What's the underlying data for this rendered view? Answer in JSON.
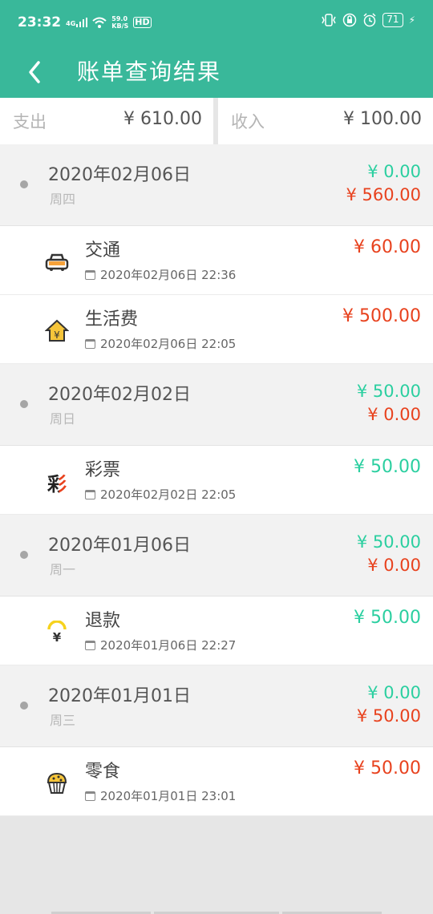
{
  "status": {
    "time": "23:32",
    "net": "4G",
    "speed_top": "59.0",
    "speed_bottom": "KB/S",
    "hd": "HD",
    "battery": "71"
  },
  "appbar": {
    "title": "账单查询结果",
    "back_icon": "chevron-left-icon"
  },
  "summary": {
    "expense_label": "支出",
    "expense_value": "¥ 610.00",
    "income_label": "收入",
    "income_value": "¥ 100.00"
  },
  "colors": {
    "primary": "#39b89a",
    "income": "#2bcfa0",
    "expense": "#e8421e"
  },
  "days": [
    {
      "date": "2020年02月06日",
      "weekday": "周四",
      "income": "¥ 0.00",
      "expense": "¥ 560.00",
      "items": [
        {
          "name": "交通",
          "time": "2020年02月06日  22:36",
          "amount": "¥ 60.00",
          "type": "expense",
          "icon": "car-icon"
        },
        {
          "name": "生活费",
          "time": "2020年02月06日  22:05",
          "amount": "¥ 500.00",
          "type": "expense",
          "icon": "house-yen-icon"
        }
      ]
    },
    {
      "date": "2020年02月02日",
      "weekday": "周日",
      "income": "¥ 50.00",
      "expense": "¥ 0.00",
      "items": [
        {
          "name": "彩票",
          "time": "2020年02月02日  22:05",
          "amount": "¥ 50.00",
          "type": "income",
          "icon": "lottery-icon",
          "icon_text": "彩"
        }
      ]
    },
    {
      "date": "2020年01月06日",
      "weekday": "周一",
      "income": "¥ 50.00",
      "expense": "¥ 0.00",
      "items": [
        {
          "name": "退款",
          "time": "2020年01月06日  22:27",
          "amount": "¥ 50.00",
          "type": "income",
          "icon": "refund-yen-icon"
        }
      ]
    },
    {
      "date": "2020年01月01日",
      "weekday": "周三",
      "income": "¥ 0.00",
      "expense": "¥ 50.00",
      "items": [
        {
          "name": "零食",
          "time": "2020年01月01日  23:01",
          "amount": "¥ 50.00",
          "type": "expense",
          "icon": "muffin-icon"
        }
      ]
    }
  ]
}
